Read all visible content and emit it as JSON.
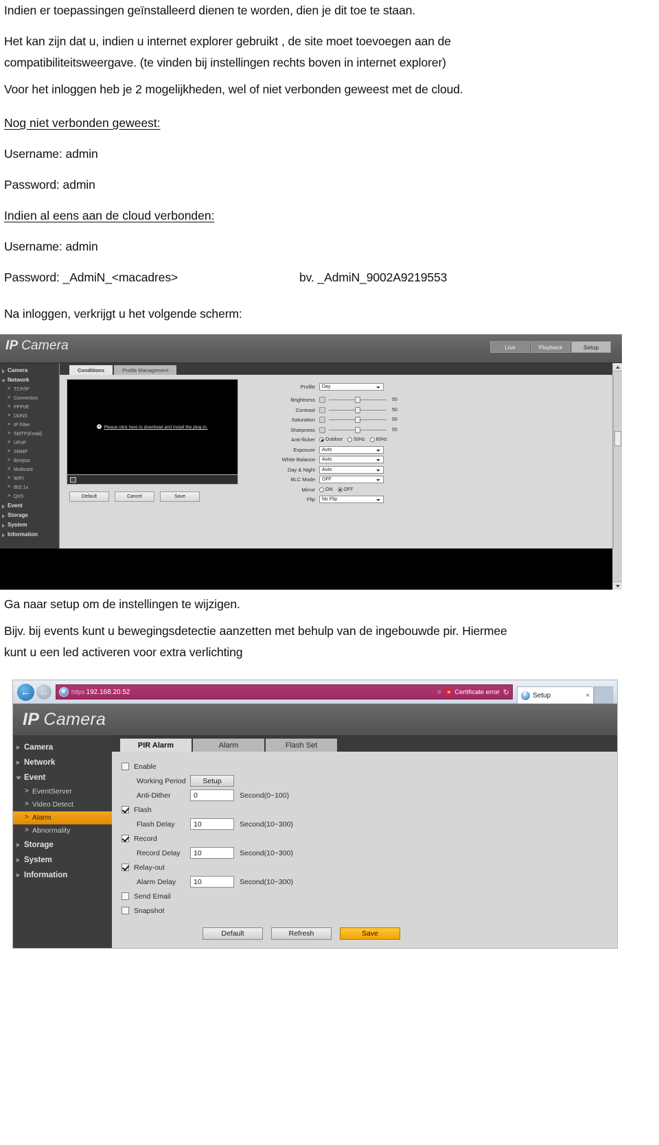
{
  "document": {
    "paragraphs": [
      "Indien er toepassingen geïnstalleerd dienen te worden, dien je dit toe te staan.",
      "Het kan zijn dat u, indien u internet explorer gebruikt , de site moet toevoegen aan de",
      "compatibiliteitsweergave. (te vinden bij instellingen rechts boven in internet explorer)",
      "Voor het inloggen heb je 2 mogelijkheden, wel of niet verbonden geweest met de cloud."
    ],
    "section1_heading": "Nog niet verbonden geweest:",
    "section1_username": "Username: admin",
    "section1_password": "Password: admin",
    "section2_heading": "Indien al eens aan de cloud verbonden:",
    "section2_username": "Username: admin",
    "section2_password": "Password: _AdmiN_<macadres>",
    "section2_password_example": "bv. _AdmiN_9002A9219553",
    "caption_after_login": "Na inloggen, verkrijgt u het volgende scherm:",
    "caption_goto_setup": "Ga naar setup om de instellingen te wijzigen.",
    "caption_events_1": "Bijv. bij events kunt u bewegingsdetectie aanzetten met behulp van de ingebouwde pir. Hiermee",
    "caption_events_2": "kunt u een led activeren voor extra verlichting"
  },
  "shot1": {
    "brand_bold": "IP",
    "brand_thin": "Camera",
    "topnav": [
      {
        "label": "Live",
        "active": false
      },
      {
        "label": "Playback",
        "active": false
      },
      {
        "label": "Setup",
        "active": true
      }
    ],
    "sidebar": [
      {
        "label": "Camera",
        "type": "top",
        "open": false
      },
      {
        "label": "Network",
        "type": "top",
        "open": true
      },
      {
        "label": "TCP/IP",
        "type": "sub"
      },
      {
        "label": "Connection",
        "type": "sub"
      },
      {
        "label": "PPPoE",
        "type": "sub"
      },
      {
        "label": "DDNS",
        "type": "sub"
      },
      {
        "label": "IP Filter",
        "type": "sub"
      },
      {
        "label": "SMTP(Email)",
        "type": "sub"
      },
      {
        "label": "UPnP",
        "type": "sub"
      },
      {
        "label": "SNMP",
        "type": "sub"
      },
      {
        "label": "Bonjour",
        "type": "sub"
      },
      {
        "label": "Multicast",
        "type": "sub"
      },
      {
        "label": "WIFI",
        "type": "sub"
      },
      {
        "label": "802.1x",
        "type": "sub"
      },
      {
        "label": "QoS",
        "type": "sub"
      },
      {
        "label": "Event",
        "type": "top",
        "open": false
      },
      {
        "label": "Storage",
        "type": "top",
        "open": false
      },
      {
        "label": "System",
        "type": "top",
        "open": false
      },
      {
        "label": "Information",
        "type": "top",
        "open": false
      }
    ],
    "tabs": [
      {
        "label": "Conditions",
        "active": true
      },
      {
        "label": "Profile Management",
        "active": false
      }
    ],
    "video_plugin_message": "Please click here to download and install the plug-in.",
    "settings": {
      "profile_label": "Profile",
      "profile_value": "Day",
      "brightness_label": "Brightness",
      "brightness_value": "50",
      "contrast_label": "Contrast",
      "contrast_value": "50",
      "saturation_label": "Saturation",
      "saturation_value": "50",
      "sharpness_label": "Sharpness",
      "sharpness_value": "50",
      "antiflicker_label": "Anti-flicker",
      "antiflicker_options": [
        {
          "label": "Outdoor",
          "selected": true
        },
        {
          "label": "50Hz",
          "selected": false
        },
        {
          "label": "60Hz",
          "selected": false
        }
      ],
      "exposure_label": "Exposure",
      "exposure_value": "Auto",
      "white_balance_label": "White Balance",
      "white_balance_value": "Auto",
      "day_night_label": "Day & Night",
      "day_night_value": "Auto",
      "blc_label": "BLC Mode",
      "blc_value": "OFF",
      "mirror_label": "Mirror",
      "mirror_options": [
        {
          "label": "ON",
          "selected": false
        },
        {
          "label": "OFF",
          "selected": true
        }
      ],
      "flip_label": "Flip",
      "flip_value": "No Flip"
    },
    "buttons": [
      {
        "label": "Default"
      },
      {
        "label": "Cancel"
      },
      {
        "label": "Save"
      }
    ]
  },
  "shot2": {
    "browser": {
      "url_scheme": "https",
      "url_host": "192.168.20.52",
      "certificate_error": "Certificate error",
      "tab_title": "Setup"
    },
    "brand_bold": "IP",
    "brand_thin": "Camera",
    "sidebar": [
      {
        "label": "Camera",
        "type": "top",
        "open": false
      },
      {
        "label": "Network",
        "type": "top",
        "open": false
      },
      {
        "label": "Event",
        "type": "top",
        "open": true
      },
      {
        "label": "EventServer",
        "type": "sub",
        "selected": false
      },
      {
        "label": "Video Detect",
        "type": "sub",
        "selected": false
      },
      {
        "label": "Alarm",
        "type": "sub",
        "selected": true
      },
      {
        "label": "Abnormality",
        "type": "sub",
        "selected": false
      },
      {
        "label": "Storage",
        "type": "top",
        "open": false
      },
      {
        "label": "System",
        "type": "top",
        "open": false
      },
      {
        "label": "Information",
        "type": "top",
        "open": false
      }
    ],
    "tabs": [
      {
        "label": "PIR Alarm",
        "active": true
      },
      {
        "label": "Alarm",
        "active": false
      },
      {
        "label": "Flash Set",
        "active": false
      }
    ],
    "form": {
      "enable_label": "Enable",
      "enable_checked": false,
      "working_period_label": "Working Period",
      "working_period_button": "Setup",
      "anti_dither_label": "Anti-Dither",
      "anti_dither_value": "0",
      "anti_dither_hint": "Second(0~100)",
      "flash_label": "Flash",
      "flash_checked": true,
      "flash_delay_label": "Flash Delay",
      "flash_delay_value": "10",
      "flash_delay_hint": "Second(10~300)",
      "record_label": "Record",
      "record_checked": true,
      "record_delay_label": "Record Delay",
      "record_delay_value": "10",
      "record_delay_hint": "Second(10~300)",
      "relay_out_label": "Relay-out",
      "relay_out_checked": true,
      "alarm_delay_label": "Alarm Delay",
      "alarm_delay_value": "10",
      "alarm_delay_hint": "Second(10~300)",
      "send_email_label": "Send Email",
      "send_email_checked": false,
      "snapshot_label": "Snapshot",
      "snapshot_checked": false
    },
    "buttons": [
      {
        "label": "Default",
        "primary": false
      },
      {
        "label": "Refresh",
        "primary": false
      },
      {
        "label": "Save",
        "primary": true
      }
    ]
  }
}
